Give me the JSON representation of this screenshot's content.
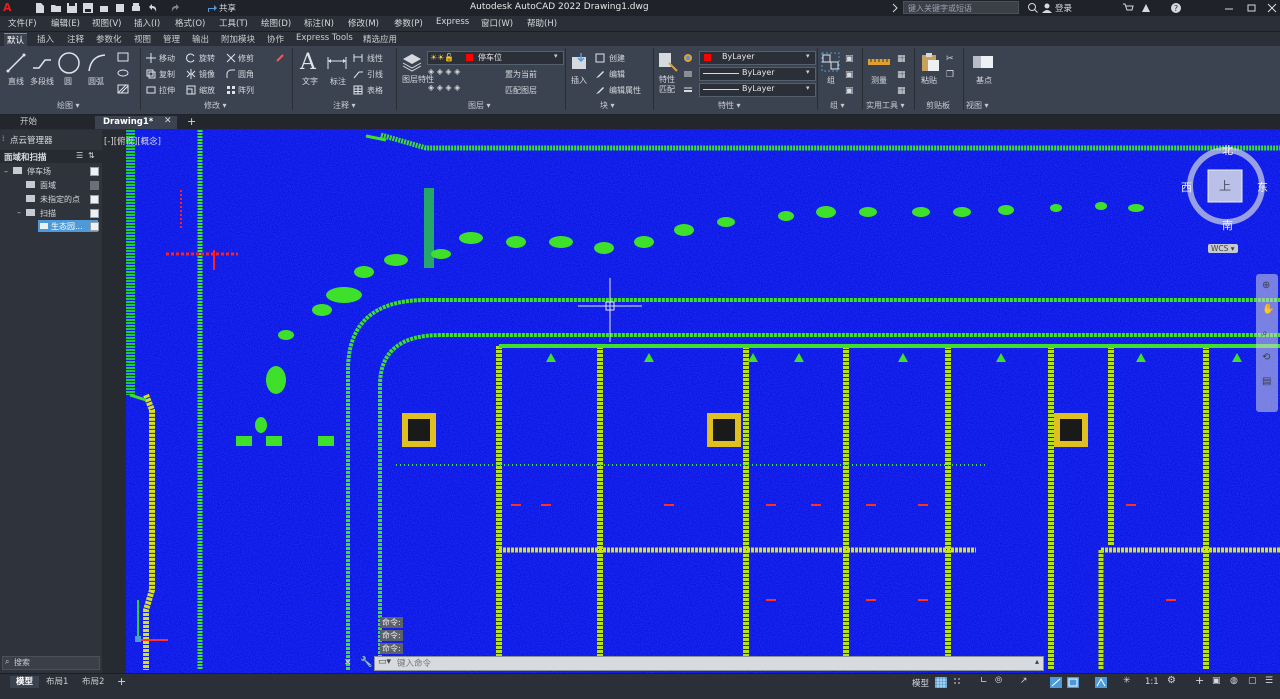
{
  "titlebar": {
    "app_title": "Autodesk AutoCAD 2022    Drawing1.dwg",
    "share_label": "共享",
    "search_placeholder": "键入关键字或短语",
    "login_label": "登录",
    "app_letter": "A"
  },
  "menubar": {
    "items": [
      "文件(F)",
      "编辑(E)",
      "视图(V)",
      "插入(I)",
      "格式(O)",
      "工具(T)",
      "绘图(D)",
      "标注(N)",
      "修改(M)",
      "参数(P)",
      "Express",
      "窗口(W)",
      "帮助(H)"
    ]
  },
  "ribbon_tabs": [
    "默认",
    "插入",
    "注释",
    "参数化",
    "视图",
    "管理",
    "输出",
    "附加模块",
    "协作",
    "Express Tools",
    "精选应用"
  ],
  "ribbon": {
    "draw": {
      "line": "直线",
      "polyline": "多段线",
      "circle": "圆",
      "arc": "圆弧",
      "panel": "绘图 ▾"
    },
    "modify": {
      "move": "移动",
      "rotate": "旋转",
      "trim": "修剪",
      "copy": "复制",
      "mirror": "镜像",
      "fillet": "圆角",
      "stretch": "拉伸",
      "scale": "缩放",
      "array": "阵列",
      "panel": "修改 ▾"
    },
    "annotation": {
      "text": "文字",
      "dim": "标注",
      "linear": "线性",
      "leader": "引线",
      "table": "表格",
      "panel": "注释 ▾"
    },
    "layers": {
      "layer_props": "图层特性",
      "current_layer": "停车位",
      "make_current": "置为当前",
      "match_layer": "匹配图层",
      "panel": "图层 ▾"
    },
    "block": {
      "insert": "插入",
      "create": "创建",
      "edit": "编辑",
      "edit_attr": "编辑属性",
      "panel": "块 ▾"
    },
    "properties": {
      "match": "特性匹配",
      "color": "ByLayer",
      "linetype": "ByLayer",
      "lineweight": "ByLayer",
      "panel": "特性 ▾"
    },
    "groups": {
      "group": "组",
      "panel": "组 ▾"
    },
    "utilities": {
      "measure": "测量",
      "panel": "实用工具 ▾"
    },
    "clipboard": {
      "paste": "粘贴",
      "panel": "剪贴板"
    },
    "view": {
      "base": "基点",
      "panel": "视图 ▾"
    }
  },
  "doc_tabs": {
    "start": "开始",
    "drawing": "Drawing1*"
  },
  "palette": {
    "title": "点云管理器",
    "section": "面域和扫描",
    "tree": [
      {
        "label": "停车场",
        "checked": true
      },
      {
        "label": "面域",
        "checked": false
      },
      {
        "label": "未指定的点",
        "checked": true
      },
      {
        "label": "扫描",
        "checked": true
      },
      {
        "label": "生态园...",
        "checked": true
      }
    ],
    "search_placeholder": "搜索"
  },
  "viewport": {
    "label": "[-][俯视][概念]",
    "viewcube": {
      "north": "北",
      "south": "南",
      "east": "东",
      "west": "西",
      "top": "上",
      "wcs": "WCS ▾"
    }
  },
  "command": {
    "history": [
      "命令:",
      "命令:",
      "命令:"
    ],
    "placeholder": "键入命令"
  },
  "layout_tabs": [
    "模型",
    "布局1",
    "布局2"
  ],
  "statusbar": {
    "model_label": "模型",
    "scale": "1:1"
  },
  "colors": {
    "viewport_bg": "#0a14e6",
    "ribbon_bg": "#3c4350",
    "accent": "#4e9ad8",
    "layer_red": "#ff0000"
  }
}
